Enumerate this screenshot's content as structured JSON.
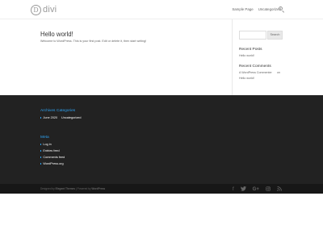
{
  "header": {
    "logo_mark": "D",
    "logo_text": "divi",
    "nav": [
      {
        "label": "Sample Page"
      },
      {
        "label": "Uncategorized"
      }
    ]
  },
  "post": {
    "title": "Hello world!",
    "excerpt": "Welcome to WordPress. This is your first post. Edit or delete it, then start writing!"
  },
  "sidebar": {
    "search_button": "Search",
    "recent_posts_title": "Recent Posts",
    "recent_posts": [
      "Hello world!"
    ],
    "recent_comments_title": "Recent Comments",
    "recent_comment": {
      "author": "A WordPress Commenter",
      "on": "on",
      "post": "Hello world!"
    }
  },
  "footer": {
    "archives_title": "Archives",
    "categories_title": "Categories",
    "archives": [
      "June 2020"
    ],
    "categories": [
      "Uncategorized"
    ],
    "meta_title": "Meta",
    "meta_items": [
      "Log in",
      "Entries feed",
      "Comments feed",
      "WordPress.org"
    ]
  },
  "bottom": {
    "credits_prefix": "Designed by",
    "credits_theme": "Elegant Themes",
    "credits_sep": "| Powered by",
    "credits_wp": "WordPress",
    "social_icons": [
      "facebook-icon",
      "twitter-icon",
      "google-plus-icon",
      "instagram-icon",
      "rss-icon"
    ]
  },
  "colors": {
    "accent": "#2ea3f2",
    "footer_bg": "#222222",
    "bottom_bar_bg": "#171717"
  }
}
